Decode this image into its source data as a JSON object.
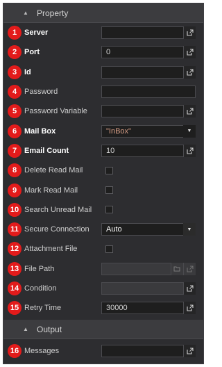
{
  "sections": {
    "property": "Property",
    "output": "Output"
  },
  "rows": {
    "server": {
      "badge": "1",
      "label": "Server",
      "value": ""
    },
    "port": {
      "badge": "2",
      "label": "Port",
      "value": "0"
    },
    "id": {
      "badge": "3",
      "label": "Id",
      "value": ""
    },
    "password": {
      "badge": "4",
      "label": "Password",
      "value": ""
    },
    "password_variable": {
      "badge": "5",
      "label": "Password Variable",
      "value": ""
    },
    "mail_box": {
      "badge": "6",
      "label": "Mail Box",
      "value": "\"InBox\""
    },
    "email_count": {
      "badge": "7",
      "label": "Email Count",
      "value": "10"
    },
    "delete_read_mail": {
      "badge": "8",
      "label": "Delete Read Mail",
      "checked": false
    },
    "mark_read_mail": {
      "badge": "9",
      "label": "Mark Read Mail",
      "checked": false
    },
    "search_unread_mail": {
      "badge": "10",
      "label": "Search Unread Mail",
      "checked": false
    },
    "secure_connection": {
      "badge": "11",
      "label": "Secure Connection",
      "value": "Auto"
    },
    "attachment_file": {
      "badge": "12",
      "label": "Attachment File",
      "checked": false
    },
    "file_path": {
      "badge": "13",
      "label": "File Path",
      "value": ""
    },
    "condition": {
      "badge": "14",
      "label": "Condition",
      "value": ""
    },
    "retry_time": {
      "badge": "15",
      "label": "Retry Time",
      "value": "30000"
    },
    "messages": {
      "badge": "16",
      "label": "Messages",
      "value": ""
    }
  },
  "icons": {
    "section_toggle": "caret-up-icon",
    "open_editor": "external-link-icon",
    "folder": "folder-icon",
    "dropdown": "caret-down-icon"
  },
  "colors": {
    "badge": "#e31b1b",
    "panel_bg": "#2d2d30",
    "string_value": "#d69d85"
  }
}
